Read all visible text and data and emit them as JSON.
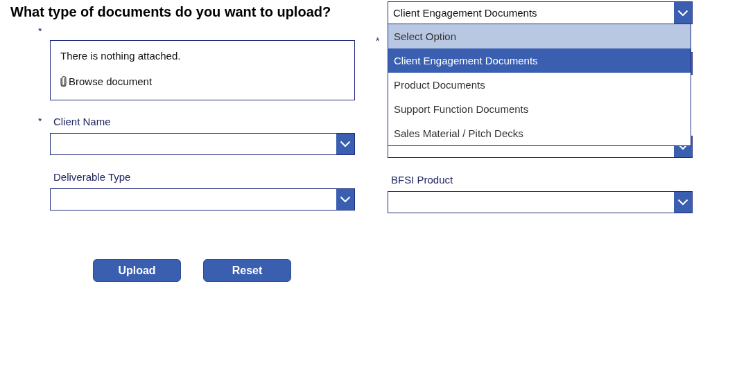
{
  "heading": "What type of documents do you want to upload?",
  "document_type": {
    "value": "Client Engagement Documents",
    "expanded": true,
    "options": [
      {
        "label": "Select Option",
        "selected": false,
        "hovered": true
      },
      {
        "label": "Client Engagement Documents",
        "selected": true,
        "hovered": false
      },
      {
        "label": "Product Documents",
        "selected": false,
        "hovered": false
      },
      {
        "label": "Support Function Documents",
        "selected": false,
        "hovered": false
      },
      {
        "label": "Sales Material / Pitch Decks",
        "selected": false,
        "hovered": false
      }
    ]
  },
  "left_column": [
    {
      "kind": "attachment",
      "marker": "*",
      "message": "There is nothing attached.",
      "browse_label": "Browse document"
    },
    {
      "kind": "dropdown",
      "label": "Client Name",
      "marker": "*"
    },
    {
      "kind": "dropdown",
      "label": "Deliverable Type"
    }
  ],
  "right_column": [
    {
      "kind": "dropdown",
      "marker": "*"
    },
    {
      "kind": "dropdown"
    },
    {
      "kind": "dropdown",
      "label": "BFSI Product"
    }
  ],
  "buttons": [
    {
      "label": "Upload"
    },
    {
      "label": "Reset"
    }
  ]
}
